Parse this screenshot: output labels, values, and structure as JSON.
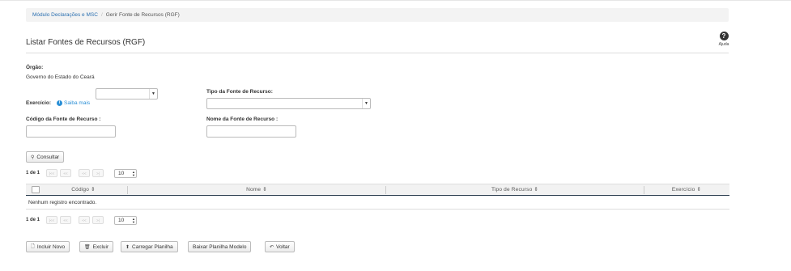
{
  "breadcrumb": {
    "module": "Módulo Declarações e MSC",
    "current": "Gerir Fonte de Recursos (RGF)"
  },
  "page": {
    "title": "Listar Fontes de Recursos (RGF)"
  },
  "help": {
    "label": "Ajuda"
  },
  "form": {
    "orgao_label": "Órgão:",
    "orgao_value": "Governo do Estado do Ceará",
    "exercicio_label": "Exercício:",
    "saiba_mais": "Saiba mais",
    "exercicio_value": "",
    "tipo_label": "Tipo da Fonte de Recurso:",
    "tipo_value": "",
    "codigo_label": "Código da Fonte de Recurso :",
    "codigo_value": "",
    "nome_label": "Nome da Fonte de Recurso :",
    "nome_value": ""
  },
  "actions": {
    "consultar": "Consultar"
  },
  "pager": {
    "count": "1 de 1",
    "first": "|<<",
    "prev_block": "<<",
    "prev": "<<",
    "next": ">|",
    "rows": "10"
  },
  "table": {
    "columns": [
      "Código",
      "Nome",
      "Tipo de Recurso",
      "Exercício"
    ],
    "sort_glyph": "⇕",
    "empty_message": "Nenhum registro encontrado."
  },
  "bottom_buttons": {
    "incluir": "Incluir Novo",
    "excluir": "Excluir",
    "carregar": "Carregar Planilha",
    "baixar": "Baixar Planilha Modelo",
    "voltar": "Voltar"
  },
  "icons": {
    "help": "question-circle-icon",
    "info": "info-circle-icon",
    "search": "search-icon",
    "document": "document-icon",
    "trash": "trash-icon",
    "upload": "upload-icon",
    "back": "back-arrow-icon"
  },
  "colors": {
    "link": "#2a6fb0",
    "info": "#2a8fd6",
    "table_header_rule": "#2a3d4f"
  }
}
